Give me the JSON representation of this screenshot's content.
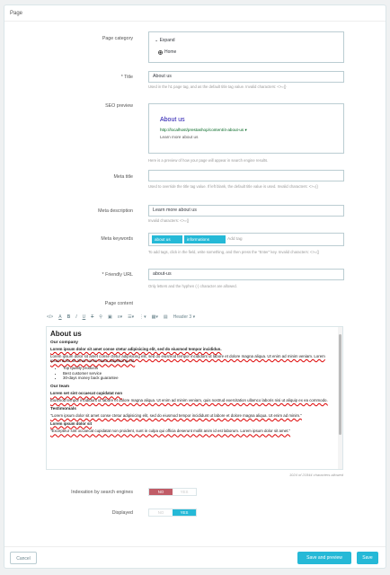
{
  "panel": {
    "title": "Page"
  },
  "category": {
    "label": "Page category",
    "expand": "Expand",
    "home": "Home"
  },
  "title": {
    "label": "* Title",
    "value": "About us",
    "help": "Used in the h1 page tag, and as the default title tag value. Invalid characters: <>={}"
  },
  "seo": {
    "label": "SEO preview",
    "title": "About us",
    "url": "http://localhost/prestashop/content/4-about-us",
    "desc": "Learn more about us",
    "help": "Here is a preview of how your page will appear in search engine results."
  },
  "meta_title": {
    "label": "Meta title",
    "value": "",
    "help": "Used to override the title tag value. If left blank, the default title value is used. Invalid characters: <>={}"
  },
  "meta_desc": {
    "label": "Meta description",
    "value": "Learn more about us",
    "help": "Invalid characters: <>={}"
  },
  "meta_keywords": {
    "label": "Meta keywords",
    "tags": [
      "about us",
      "informations"
    ],
    "placeholder": "Add tag",
    "help": "To add tags, click in the field, write something, and then press the \"Enter\" key. Invalid characters: <>={}"
  },
  "friendly": {
    "label": "* Friendly URL",
    "value": "about-us",
    "help": "Only letters and the hyphen (-) character are allowed."
  },
  "content": {
    "label": "Page content",
    "format": "Header 3",
    "counter": "1024 of 21844 characters allowed"
  },
  "editor": {
    "h1": "About us",
    "company": "Our company",
    "c1": "Lorem ipsum dolor sit amet conse ctetur adipisicing elit, sed do eiusmod tempor incididun.",
    "c2": "Lorem ipsum dolor sit amet conse ctetur adipisicing elit, sed do eiusmod tempor incididunt ut labore et dolore magna aliqua. Ut enim ad minim veniam. Lorem ipsum dolor sit amet conse ctetur adipisicing elit.",
    "list": [
      "Top quality products",
      "Best customer service",
      "30-days money back guarantee"
    ],
    "team": "Our team",
    "t1": "Lorem set sint occaecat cupidatat non",
    "t2": "Eiusmod tempor incididunt ut labore et dolore magna aliqua. Ut enim ad minim veniam, quis nostrud exercitation ullamco laboris nisi ut aliquip ex ea commodo.",
    "testi": "Testimonials",
    "q1": "\"Lorem ipsum dolor sit amet conse ctetur adipisicing elit, sed do eiusmod tempor incididunt ut labore et dolore magna aliqua. Ut enim ad minim.\"",
    "q1by": "Lorem ipsum dolor sit",
    "q2": "\"Excepteur sint occaecat cupidatat non proident, sunt in culpa qui officia deserunt mollit anim id est laborum. Lorem ipsum dolor sit amet.\""
  },
  "indexation": {
    "label": "Indexation by search engines",
    "no": "NO",
    "yes": "YES"
  },
  "displayed": {
    "label": "Displayed",
    "no": "NO",
    "yes": "YES"
  },
  "footer": {
    "cancel": "Cancel",
    "save_preview": "Save and preview",
    "save": "Save"
  },
  "colors": {
    "accent": "#25b9d7",
    "danger": "#c05c67"
  }
}
